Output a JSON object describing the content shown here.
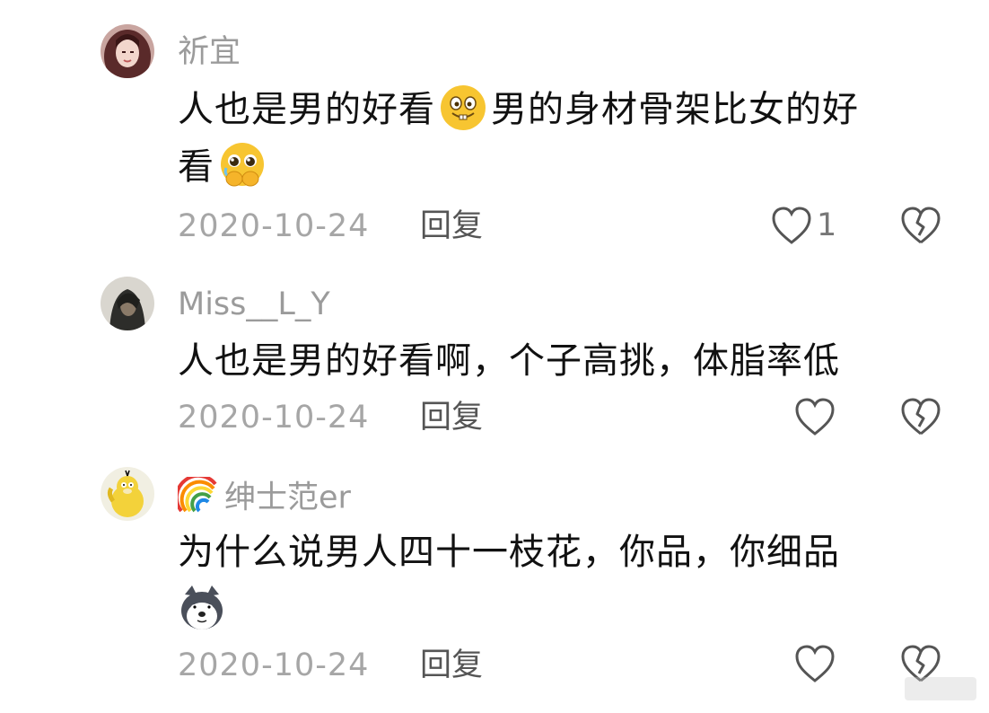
{
  "comments": [
    {
      "username": "祈宜",
      "text_line1_part1": "人也是男的好看",
      "text_line1_part2": "男的身材骨架比女的好",
      "text_line2": "看",
      "date": "2020-10-24",
      "reply_label": "回复",
      "like_count": "1",
      "emojis": [
        "grin-emoji",
        "pleading-emoji"
      ]
    },
    {
      "username": "Miss__L_Y",
      "text": "人也是男的好看啊，个子高挑，体脂率低",
      "date": "2020-10-24",
      "reply_label": "回复",
      "like_count": ""
    },
    {
      "username": "绅士范er",
      "username_prefix_icon": "rainbow-emoji",
      "text": "为什么说男人四十一枝花，你品，你细品",
      "date": "2020-10-24",
      "reply_label": "回复",
      "like_count": "",
      "emojis": [
        "husky-emoji"
      ]
    }
  ]
}
